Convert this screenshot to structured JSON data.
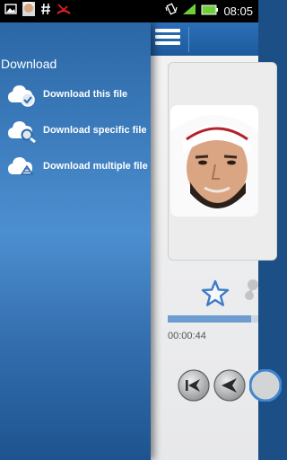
{
  "status_bar": {
    "time": "08:05",
    "icons": [
      "gallery-icon",
      "avatar-thumbnail",
      "hash-icon",
      "missed-call-icon",
      "vibrate-icon",
      "signal-icon",
      "battery-icon"
    ]
  },
  "drawer": {
    "title": "Download",
    "items": [
      {
        "label": "Download this file",
        "icon": "cloud-check-icon"
      },
      {
        "label": "Download specific file",
        "icon": "cloud-search-icon"
      },
      {
        "label": "Download multiple file",
        "icon": "cloud-stack-icon"
      }
    ]
  },
  "player": {
    "current_time": "00:00:44",
    "progress": 0.92,
    "icons": [
      "menu-icon",
      "star-icon",
      "share-icon",
      "previous-icon",
      "rewind-icon",
      "play-icon"
    ]
  },
  "colors": {
    "drawer_top": "#2b67a6",
    "drawer_mid": "#4c8fd0",
    "accent": "#6d9cd0",
    "topbar": "#2c6fb8"
  }
}
